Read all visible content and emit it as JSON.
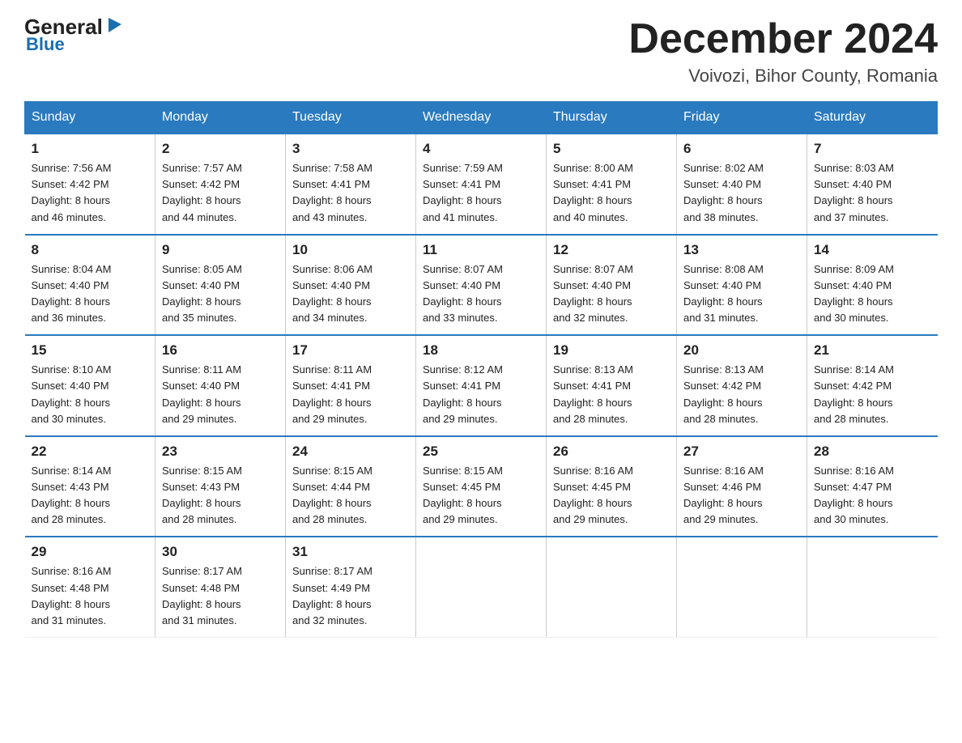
{
  "logo": {
    "general": "General",
    "blue": "Blue",
    "triangle": "▶"
  },
  "header": {
    "month": "December 2024",
    "location": "Voivozi, Bihor County, Romania"
  },
  "weekdays": [
    "Sunday",
    "Monday",
    "Tuesday",
    "Wednesday",
    "Thursday",
    "Friday",
    "Saturday"
  ],
  "weeks": [
    [
      {
        "day": "1",
        "info": "Sunrise: 7:56 AM\nSunset: 4:42 PM\nDaylight: 8 hours\nand 46 minutes."
      },
      {
        "day": "2",
        "info": "Sunrise: 7:57 AM\nSunset: 4:42 PM\nDaylight: 8 hours\nand 44 minutes."
      },
      {
        "day": "3",
        "info": "Sunrise: 7:58 AM\nSunset: 4:41 PM\nDaylight: 8 hours\nand 43 minutes."
      },
      {
        "day": "4",
        "info": "Sunrise: 7:59 AM\nSunset: 4:41 PM\nDaylight: 8 hours\nand 41 minutes."
      },
      {
        "day": "5",
        "info": "Sunrise: 8:00 AM\nSunset: 4:41 PM\nDaylight: 8 hours\nand 40 minutes."
      },
      {
        "day": "6",
        "info": "Sunrise: 8:02 AM\nSunset: 4:40 PM\nDaylight: 8 hours\nand 38 minutes."
      },
      {
        "day": "7",
        "info": "Sunrise: 8:03 AM\nSunset: 4:40 PM\nDaylight: 8 hours\nand 37 minutes."
      }
    ],
    [
      {
        "day": "8",
        "info": "Sunrise: 8:04 AM\nSunset: 4:40 PM\nDaylight: 8 hours\nand 36 minutes."
      },
      {
        "day": "9",
        "info": "Sunrise: 8:05 AM\nSunset: 4:40 PM\nDaylight: 8 hours\nand 35 minutes."
      },
      {
        "day": "10",
        "info": "Sunrise: 8:06 AM\nSunset: 4:40 PM\nDaylight: 8 hours\nand 34 minutes."
      },
      {
        "day": "11",
        "info": "Sunrise: 8:07 AM\nSunset: 4:40 PM\nDaylight: 8 hours\nand 33 minutes."
      },
      {
        "day": "12",
        "info": "Sunrise: 8:07 AM\nSunset: 4:40 PM\nDaylight: 8 hours\nand 32 minutes."
      },
      {
        "day": "13",
        "info": "Sunrise: 8:08 AM\nSunset: 4:40 PM\nDaylight: 8 hours\nand 31 minutes."
      },
      {
        "day": "14",
        "info": "Sunrise: 8:09 AM\nSunset: 4:40 PM\nDaylight: 8 hours\nand 30 minutes."
      }
    ],
    [
      {
        "day": "15",
        "info": "Sunrise: 8:10 AM\nSunset: 4:40 PM\nDaylight: 8 hours\nand 30 minutes."
      },
      {
        "day": "16",
        "info": "Sunrise: 8:11 AM\nSunset: 4:40 PM\nDaylight: 8 hours\nand 29 minutes."
      },
      {
        "day": "17",
        "info": "Sunrise: 8:11 AM\nSunset: 4:41 PM\nDaylight: 8 hours\nand 29 minutes."
      },
      {
        "day": "18",
        "info": "Sunrise: 8:12 AM\nSunset: 4:41 PM\nDaylight: 8 hours\nand 29 minutes."
      },
      {
        "day": "19",
        "info": "Sunrise: 8:13 AM\nSunset: 4:41 PM\nDaylight: 8 hours\nand 28 minutes."
      },
      {
        "day": "20",
        "info": "Sunrise: 8:13 AM\nSunset: 4:42 PM\nDaylight: 8 hours\nand 28 minutes."
      },
      {
        "day": "21",
        "info": "Sunrise: 8:14 AM\nSunset: 4:42 PM\nDaylight: 8 hours\nand 28 minutes."
      }
    ],
    [
      {
        "day": "22",
        "info": "Sunrise: 8:14 AM\nSunset: 4:43 PM\nDaylight: 8 hours\nand 28 minutes."
      },
      {
        "day": "23",
        "info": "Sunrise: 8:15 AM\nSunset: 4:43 PM\nDaylight: 8 hours\nand 28 minutes."
      },
      {
        "day": "24",
        "info": "Sunrise: 8:15 AM\nSunset: 4:44 PM\nDaylight: 8 hours\nand 28 minutes."
      },
      {
        "day": "25",
        "info": "Sunrise: 8:15 AM\nSunset: 4:45 PM\nDaylight: 8 hours\nand 29 minutes."
      },
      {
        "day": "26",
        "info": "Sunrise: 8:16 AM\nSunset: 4:45 PM\nDaylight: 8 hours\nand 29 minutes."
      },
      {
        "day": "27",
        "info": "Sunrise: 8:16 AM\nSunset: 4:46 PM\nDaylight: 8 hours\nand 29 minutes."
      },
      {
        "day": "28",
        "info": "Sunrise: 8:16 AM\nSunset: 4:47 PM\nDaylight: 8 hours\nand 30 minutes."
      }
    ],
    [
      {
        "day": "29",
        "info": "Sunrise: 8:16 AM\nSunset: 4:48 PM\nDaylight: 8 hours\nand 31 minutes."
      },
      {
        "day": "30",
        "info": "Sunrise: 8:17 AM\nSunset: 4:48 PM\nDaylight: 8 hours\nand 31 minutes."
      },
      {
        "day": "31",
        "info": "Sunrise: 8:17 AM\nSunset: 4:49 PM\nDaylight: 8 hours\nand 32 minutes."
      },
      {
        "day": "",
        "info": ""
      },
      {
        "day": "",
        "info": ""
      },
      {
        "day": "",
        "info": ""
      },
      {
        "day": "",
        "info": ""
      }
    ]
  ]
}
